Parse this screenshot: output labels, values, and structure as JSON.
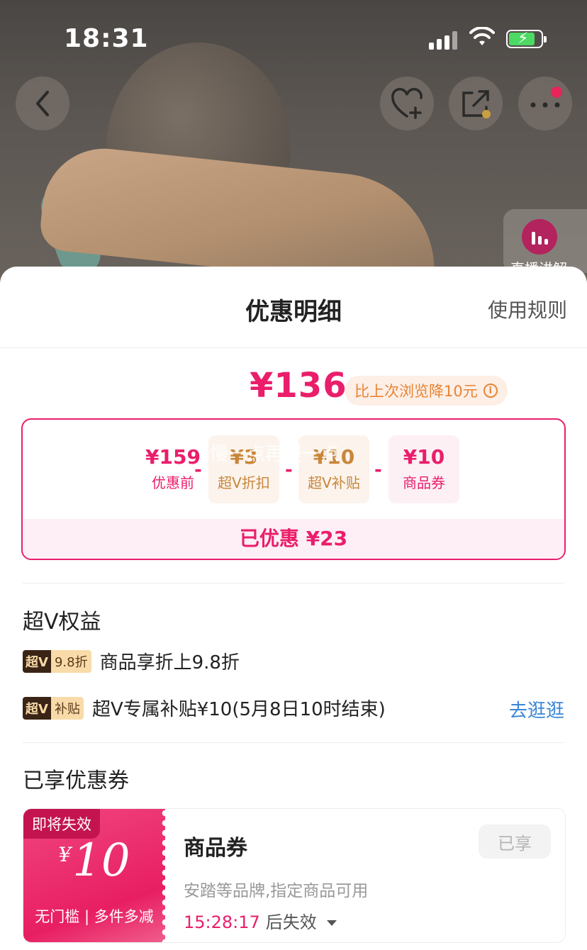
{
  "status_bar": {
    "time": "18:31"
  },
  "background": {
    "live_label": "直播讲解"
  },
  "sheet": {
    "title": "优惠明细",
    "rules_link": "使用规则",
    "final_price": "¥136",
    "price_drop_note": "比上次浏览降10元",
    "breakdown": [
      {
        "value": "¥159",
        "label": "优惠前"
      },
      {
        "value": "¥3",
        "label": "超V折扣"
      },
      {
        "value": "¥10",
        "label": "超V补贴"
      },
      {
        "value": "¥10",
        "label": "商品券"
      }
    ],
    "watermark": "慢一点再慢一点",
    "saved_total": "已优惠 ¥23"
  },
  "super_v": {
    "section_title": "超V权益",
    "benefits": [
      {
        "badge_left": "超V",
        "badge_right": "9.8折",
        "text": "商品享折上9.8折"
      },
      {
        "badge_left": "超V",
        "badge_right": "补贴",
        "text": "超V专属补贴¥10(5月8日10时结束)",
        "link": "去逛逛"
      }
    ]
  },
  "coupons": {
    "section_title": "已享优惠券",
    "items": [
      {
        "tag": "即将失效",
        "currency": "¥",
        "amount": "10",
        "condition": "无门槛 | 多件多减",
        "name": "商品券",
        "description": "安踏等品牌,指定商品可用",
        "countdown": "15:28:17",
        "countdown_suffix": "后失效",
        "button": "已享"
      }
    ]
  },
  "colors": {
    "accent": "#ea1e6b",
    "gold": "#c9863b",
    "link": "#3a86d8"
  }
}
